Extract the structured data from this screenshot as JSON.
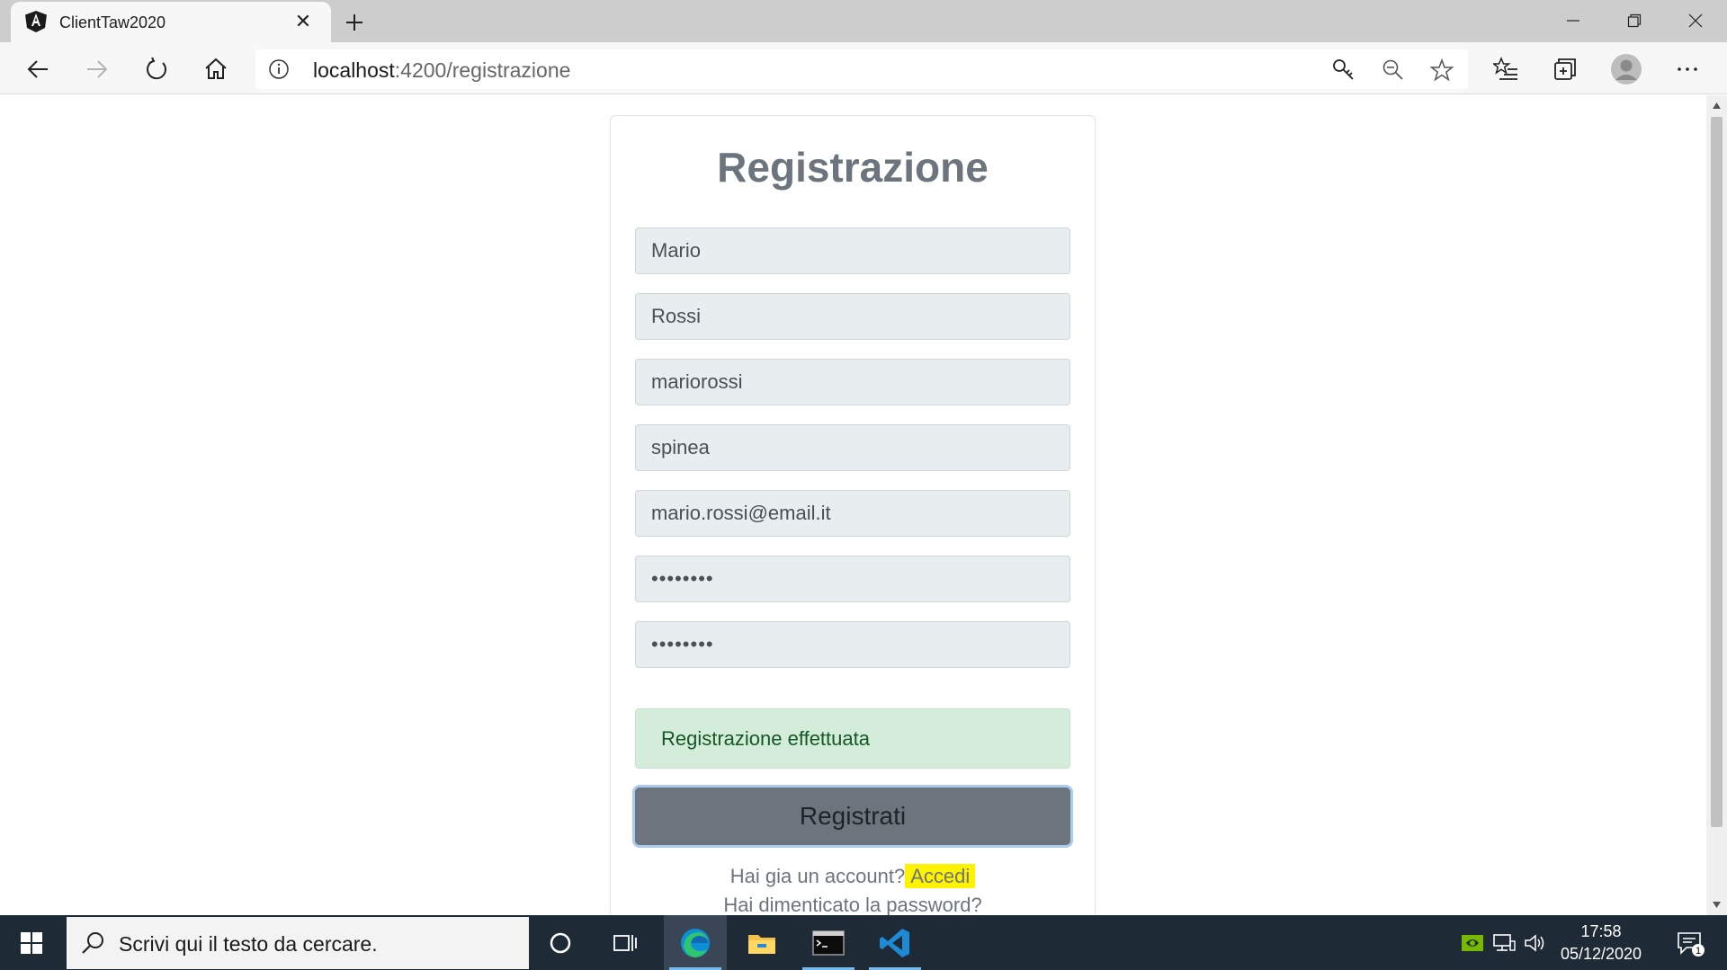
{
  "browser": {
    "tab_title": "ClientTaw2020",
    "url_host": "localhost",
    "url_path": ":4200/registrazione"
  },
  "form": {
    "title": "Registrazione",
    "fields": [
      {
        "name": "first-name-field",
        "value": "Mario"
      },
      {
        "name": "last-name-field",
        "value": "Rossi"
      },
      {
        "name": "username-field",
        "value": "mariorossi"
      },
      {
        "name": "city-field",
        "value": "spinea"
      },
      {
        "name": "email-field",
        "value": "mario.rossi@email.it"
      },
      {
        "name": "password-field",
        "value": "••••••••"
      },
      {
        "name": "confirm-password-field",
        "value": "••••••••"
      }
    ],
    "success_message": "Registrazione effettuata",
    "submit_label": "Registrati",
    "have_account_text": "Hai gia un account?",
    "login_link": "Accedi",
    "forgot_password": "Hai dimenticato la password?"
  },
  "taskbar": {
    "search_placeholder": "Scrivi qui il testo da cercare.",
    "time": "17:58",
    "date": "05/12/2020",
    "notification_count": "1"
  },
  "colors": {
    "accent": "#6c757d",
    "success_bg": "#d4edda",
    "highlight": "#fff200"
  }
}
